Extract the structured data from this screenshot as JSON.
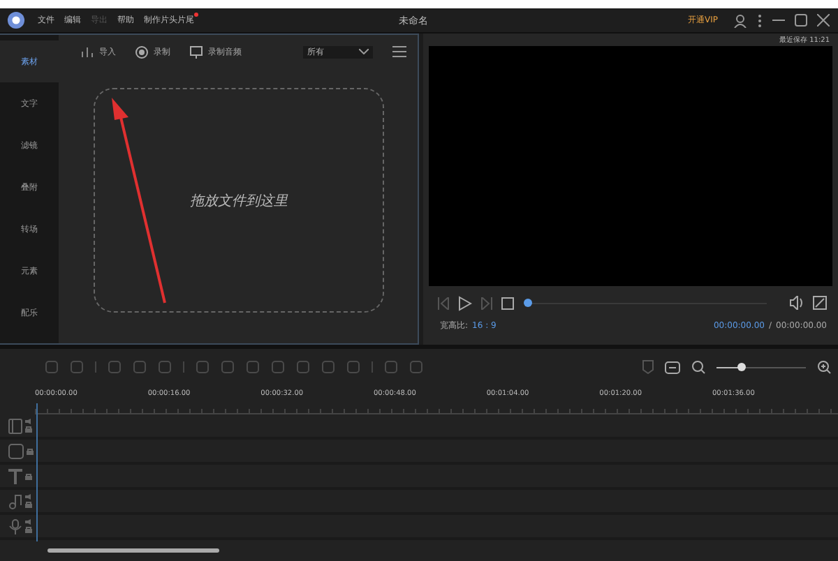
{
  "app": {
    "title": "未命名",
    "vip": "开通VIP",
    "menu": [
      {
        "label": "文件",
        "disabled": false,
        "badge": false
      },
      {
        "label": "编辑",
        "disabled": false,
        "badge": false
      },
      {
        "label": "导出",
        "disabled": true,
        "badge": false
      },
      {
        "label": "帮助",
        "disabled": false,
        "badge": false
      },
      {
        "label": "制作片头片尾",
        "disabled": false,
        "badge": true
      }
    ]
  },
  "autosave": "最近保存 11:21",
  "sidebar": [
    {
      "label": "素材",
      "selected": true
    },
    {
      "label": "文字",
      "selected": false
    },
    {
      "label": "滤镜",
      "selected": false
    },
    {
      "label": "叠附",
      "selected": false
    },
    {
      "label": "转场",
      "selected": false
    },
    {
      "label": "元素",
      "selected": false
    },
    {
      "label": "配乐",
      "selected": false
    }
  ],
  "media_toolbar": {
    "actions": [
      {
        "label": "导入",
        "kind": "import"
      },
      {
        "label": "录制",
        "kind": "record"
      },
      {
        "label": "录制音频",
        "kind": "audio"
      }
    ],
    "filter": "所有"
  },
  "dropzone": "拖放文件到这里",
  "player": {
    "progress": {
      "level": 0
    },
    "aspect_label": "宽高比:",
    "aspect": "16 : 9",
    "current": "00:00:00.00",
    "separator": "/",
    "total": "00:00:00.00"
  },
  "timeline": {
    "zoom": {
      "level": 0.28
    },
    "ruler": [
      "00:00:00.00",
      "00:00:16.00",
      "00:00:32.00",
      "00:00:48.00",
      "00:01:04.00",
      "00:01:20.00",
      "00:01:36.00"
    ],
    "tracks": [
      {
        "kind": "video"
      },
      {
        "kind": "overlay"
      },
      {
        "kind": "text"
      },
      {
        "kind": "music"
      },
      {
        "kind": "voice"
      }
    ]
  }
}
